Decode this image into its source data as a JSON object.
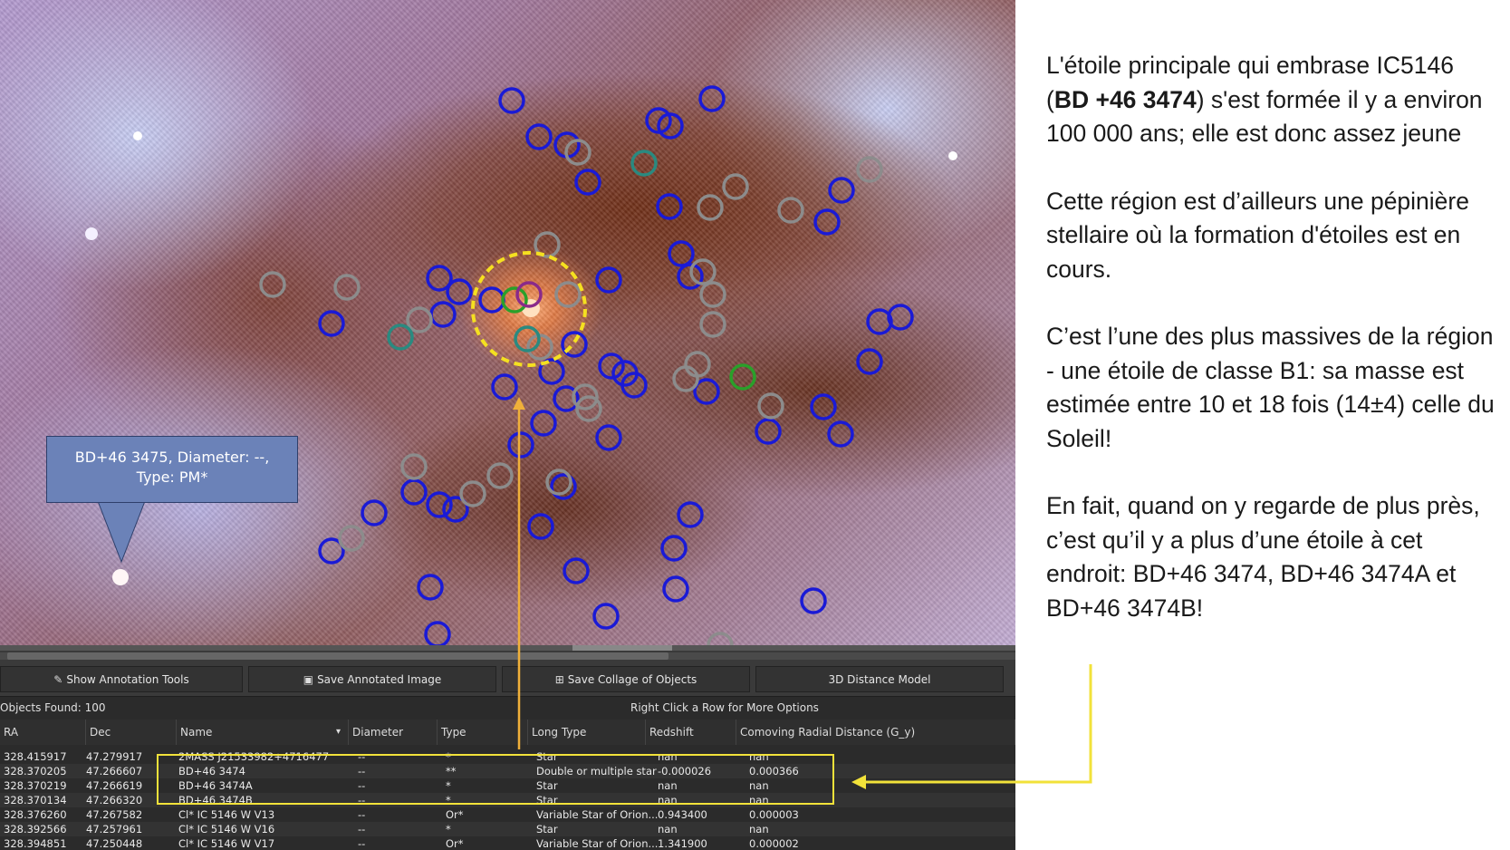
{
  "callout": {
    "line1": "BD+46  3475, Diameter: --,",
    "line2": "Type: PM*"
  },
  "toolbar": {
    "annotation_tools": "Show Annotation Tools",
    "save_annotated": "Save Annotated Image",
    "save_collage": "Save Collage of Objects",
    "distance_model": "3D Distance Model"
  },
  "status": {
    "objects_found": "Objects Found: 100",
    "hint": "Right Click a Row for More Options"
  },
  "table": {
    "columns": [
      "RA",
      "Dec",
      "Name",
      "Diameter",
      "Type",
      "Long Type",
      "Redshift",
      "Comoving Radial Distance (G_y)"
    ],
    "rows": [
      [
        "328.415917",
        "47.279917",
        "2MASS J21533982+4716477",
        "--",
        "*",
        "Star",
        "nan",
        "nan"
      ],
      [
        "328.370205",
        "47.266607",
        "BD+46  3474",
        "--",
        "**",
        "Double or multiple star",
        "-0.000026",
        "0.000366"
      ],
      [
        "328.370219",
        "47.266619",
        "BD+46  3474A",
        "--",
        "*",
        "Star",
        "nan",
        "nan"
      ],
      [
        "328.370134",
        "47.266320",
        "BD+46  3474B",
        "--",
        "*",
        "Star",
        "nan",
        "nan"
      ],
      [
        "328.376260",
        "47.267582",
        "Cl* IC 5146      W V13",
        "--",
        "Or*",
        "Variable Star of Orion...",
        "0.943400",
        "0.000003"
      ],
      [
        "328.392566",
        "47.257961",
        "Cl* IC 5146      W V16",
        "--",
        "*",
        "Star",
        "nan",
        "nan"
      ],
      [
        "328.394851",
        "47.250448",
        "Cl* IC 5146      W V17",
        "--",
        "Or*",
        "Variable Star of Orion...",
        "1.341900",
        "0.000002"
      ]
    ]
  },
  "text": {
    "p1_a": "L'étoile principale qui embrase IC5146 (",
    "p1_bold": "BD +46 3474",
    "p1_b": ") s'est formée il y a environ 100 000 ans; elle est donc assez jeune",
    "p2": "Cette région est d’ailleurs une pépinière stellaire où la formation d'étoiles est en cours.",
    "p3": "C’est l’une des plus massives de la région - une étoile de classe B1: sa masse est estimée entre 10 et 18 fois (14±4) celle du Soleil!",
    "p4": "En fait, quand on y regarde de plus près, c’est qu’il y a plus d’une étoile à cet endroit: BD+46 3474, BD+46 3474A et BD+46 3474B!"
  },
  "colors": {
    "highlight": "#f2e23a",
    "arrow_orange": "#f0b03a",
    "circle_blue": "#1a1ad6",
    "circle_gray": "#8c8c8c",
    "circle_teal": "#2a8a80"
  }
}
